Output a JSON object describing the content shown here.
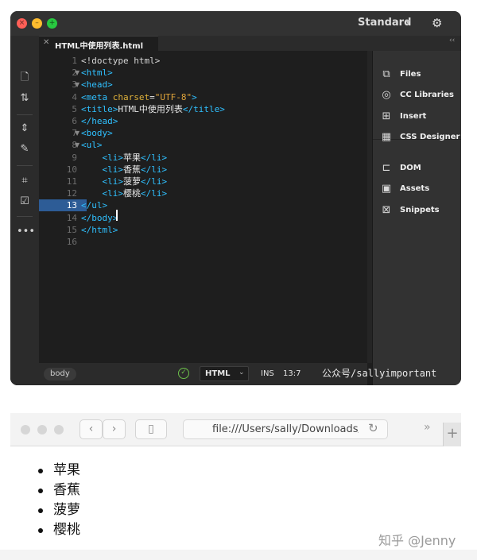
{
  "editor": {
    "workspace_label": "Standard",
    "tab_label": "HTML中使用列表.html",
    "code_lines": [
      {
        "n": "1",
        "fold": "",
        "parts": [
          {
            "t": "<!doctype html>",
            "c": "c-doctype"
          }
        ]
      },
      {
        "n": "2",
        "fold": "▼",
        "parts": [
          {
            "t": "<html>",
            "c": ""
          }
        ]
      },
      {
        "n": "3",
        "fold": "▼",
        "parts": [
          {
            "t": "<head>",
            "c": ""
          }
        ]
      },
      {
        "n": "4",
        "fold": "",
        "parts": [
          {
            "t": "<meta ",
            "c": ""
          },
          {
            "t": "charset",
            "c": "c-attr"
          },
          {
            "t": "=",
            "c": "c-text"
          },
          {
            "t": "\"UTF-8\"",
            "c": "c-val"
          },
          {
            "t": ">",
            "c": ""
          }
        ]
      },
      {
        "n": "5",
        "fold": "",
        "parts": [
          {
            "t": "<title>",
            "c": ""
          },
          {
            "t": "HTML中使用列表",
            "c": "c-text"
          },
          {
            "t": "</title>",
            "c": ""
          }
        ]
      },
      {
        "n": "6",
        "fold": "",
        "parts": [
          {
            "t": "</head>",
            "c": ""
          }
        ]
      },
      {
        "n": "7",
        "fold": "▼",
        "parts": [
          {
            "t": "<body>",
            "c": ""
          }
        ]
      },
      {
        "n": "8",
        "fold": "▼",
        "parts": [
          {
            "t": "<ul>",
            "c": ""
          }
        ]
      },
      {
        "n": "9",
        "fold": "",
        "parts": [
          {
            "t": "    <li>",
            "c": ""
          },
          {
            "t": "苹果",
            "c": "c-text"
          },
          {
            "t": "</li>",
            "c": ""
          }
        ]
      },
      {
        "n": "10",
        "fold": "",
        "parts": [
          {
            "t": "    <li>",
            "c": ""
          },
          {
            "t": "香蕉",
            "c": "c-text"
          },
          {
            "t": "</li>",
            "c": ""
          }
        ]
      },
      {
        "n": "11",
        "fold": "",
        "parts": [
          {
            "t": "    <li>",
            "c": ""
          },
          {
            "t": "菠萝",
            "c": "c-text"
          },
          {
            "t": "</li>",
            "c": ""
          }
        ]
      },
      {
        "n": "12",
        "fold": "",
        "parts": [
          {
            "t": "    <li>",
            "c": ""
          },
          {
            "t": "樱桃",
            "c": "c-text"
          },
          {
            "t": "</li>",
            "c": ""
          }
        ]
      },
      {
        "n": "13",
        "fold": "",
        "parts": [
          {
            "t": "</ul>",
            "c": ""
          }
        ]
      },
      {
        "n": "14",
        "fold": "",
        "parts": [
          {
            "t": "</body>",
            "c": ""
          }
        ]
      },
      {
        "n": "15",
        "fold": "",
        "parts": [
          {
            "t": "</html>",
            "c": ""
          }
        ]
      },
      {
        "n": "16",
        "fold": "",
        "parts": []
      }
    ],
    "active_line": "13",
    "panel_items": [
      {
        "label": "Files",
        "icon": "files-icon",
        "glyph": "⧉"
      },
      {
        "label": "CC Libraries",
        "icon": "cc-libraries-icon",
        "glyph": "◎"
      },
      {
        "label": "Insert",
        "icon": "insert-icon",
        "glyph": "⊞"
      },
      {
        "label": "CSS Designer",
        "icon": "css-designer-icon",
        "glyph": "▦"
      },
      {
        "label": "DOM",
        "icon": "dom-icon",
        "glyph": "⊏"
      },
      {
        "label": "Assets",
        "icon": "assets-icon",
        "glyph": "▣"
      },
      {
        "label": "Snippets",
        "icon": "snippets-icon",
        "glyph": "⊠"
      }
    ],
    "status": {
      "tag": "body",
      "language": "HTML",
      "mode": "INS",
      "position": "13:7"
    },
    "watermark": "公众号/sallyimportant"
  },
  "browser": {
    "url": "file:///Users/sally/Downloads/",
    "list_items": [
      "苹果",
      "香蕉",
      "菠萝",
      "樱桃"
    ]
  },
  "watermark": "知乎 @Jenny",
  "colors": {
    "editor_bg": "#1e1e1e",
    "tag": "#2fc0ff",
    "attr": "#e0b23a",
    "active_line": "#2d5c96"
  }
}
